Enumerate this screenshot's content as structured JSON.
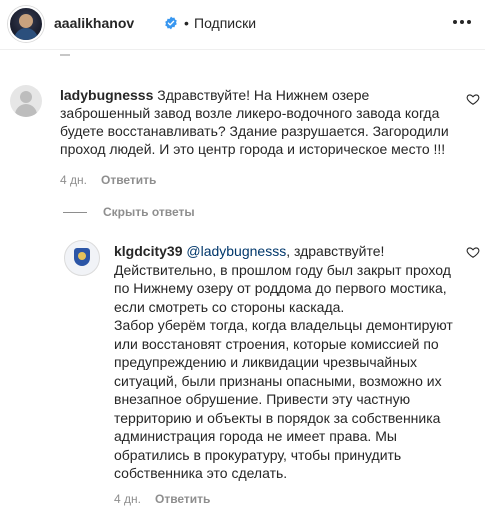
{
  "header": {
    "username": "aaalikhanov",
    "separator": "•",
    "follow_label": "Подписки"
  },
  "comment": {
    "author": "ladybugnesss",
    "text": "Здравствуйте! На Нижнем озере заброшенный завод возле ликеро-водочного завода когда будете восстанавливать? Здание разрушается. Загородили проход людей. И это центр города и историческое место !!!",
    "time": "4 дн.",
    "reply_label": "Ответить"
  },
  "hide_replies_label": "Скрыть ответы",
  "reply": {
    "author": "klgdcity39",
    "mention": "@ladybugnesss",
    "greeting": ", здравствуйте!",
    "paragraph1": "Действительно, в прошлом году был закрыт проход по Нижнему озеру от роддома до первого мостика, если смотреть со стороны каскада.",
    "paragraph2": "Забор уберём тогда, когда владельцы демонтируют или восстановят строения, которые комиссией по предупреждению и ликвидации чрезвычайных ситуаций, были признаны опасными, возможно их внезапное обрушение. Привести эту частную территорию и объекты в порядок за собственника администрация города не имеет права. Мы обратились в прокуратуру, чтобы принудить собственника это сделать.",
    "time": "4 дн.",
    "reply_label": "Ответить"
  },
  "colors": {
    "text": "#262626",
    "secondary": "#8e8e8e",
    "verified": "#3897f0",
    "mention": "#00376b"
  },
  "icons": {
    "verified": "verified-badge-icon",
    "more": "more-options-icon",
    "like": "heart-outline-icon"
  }
}
